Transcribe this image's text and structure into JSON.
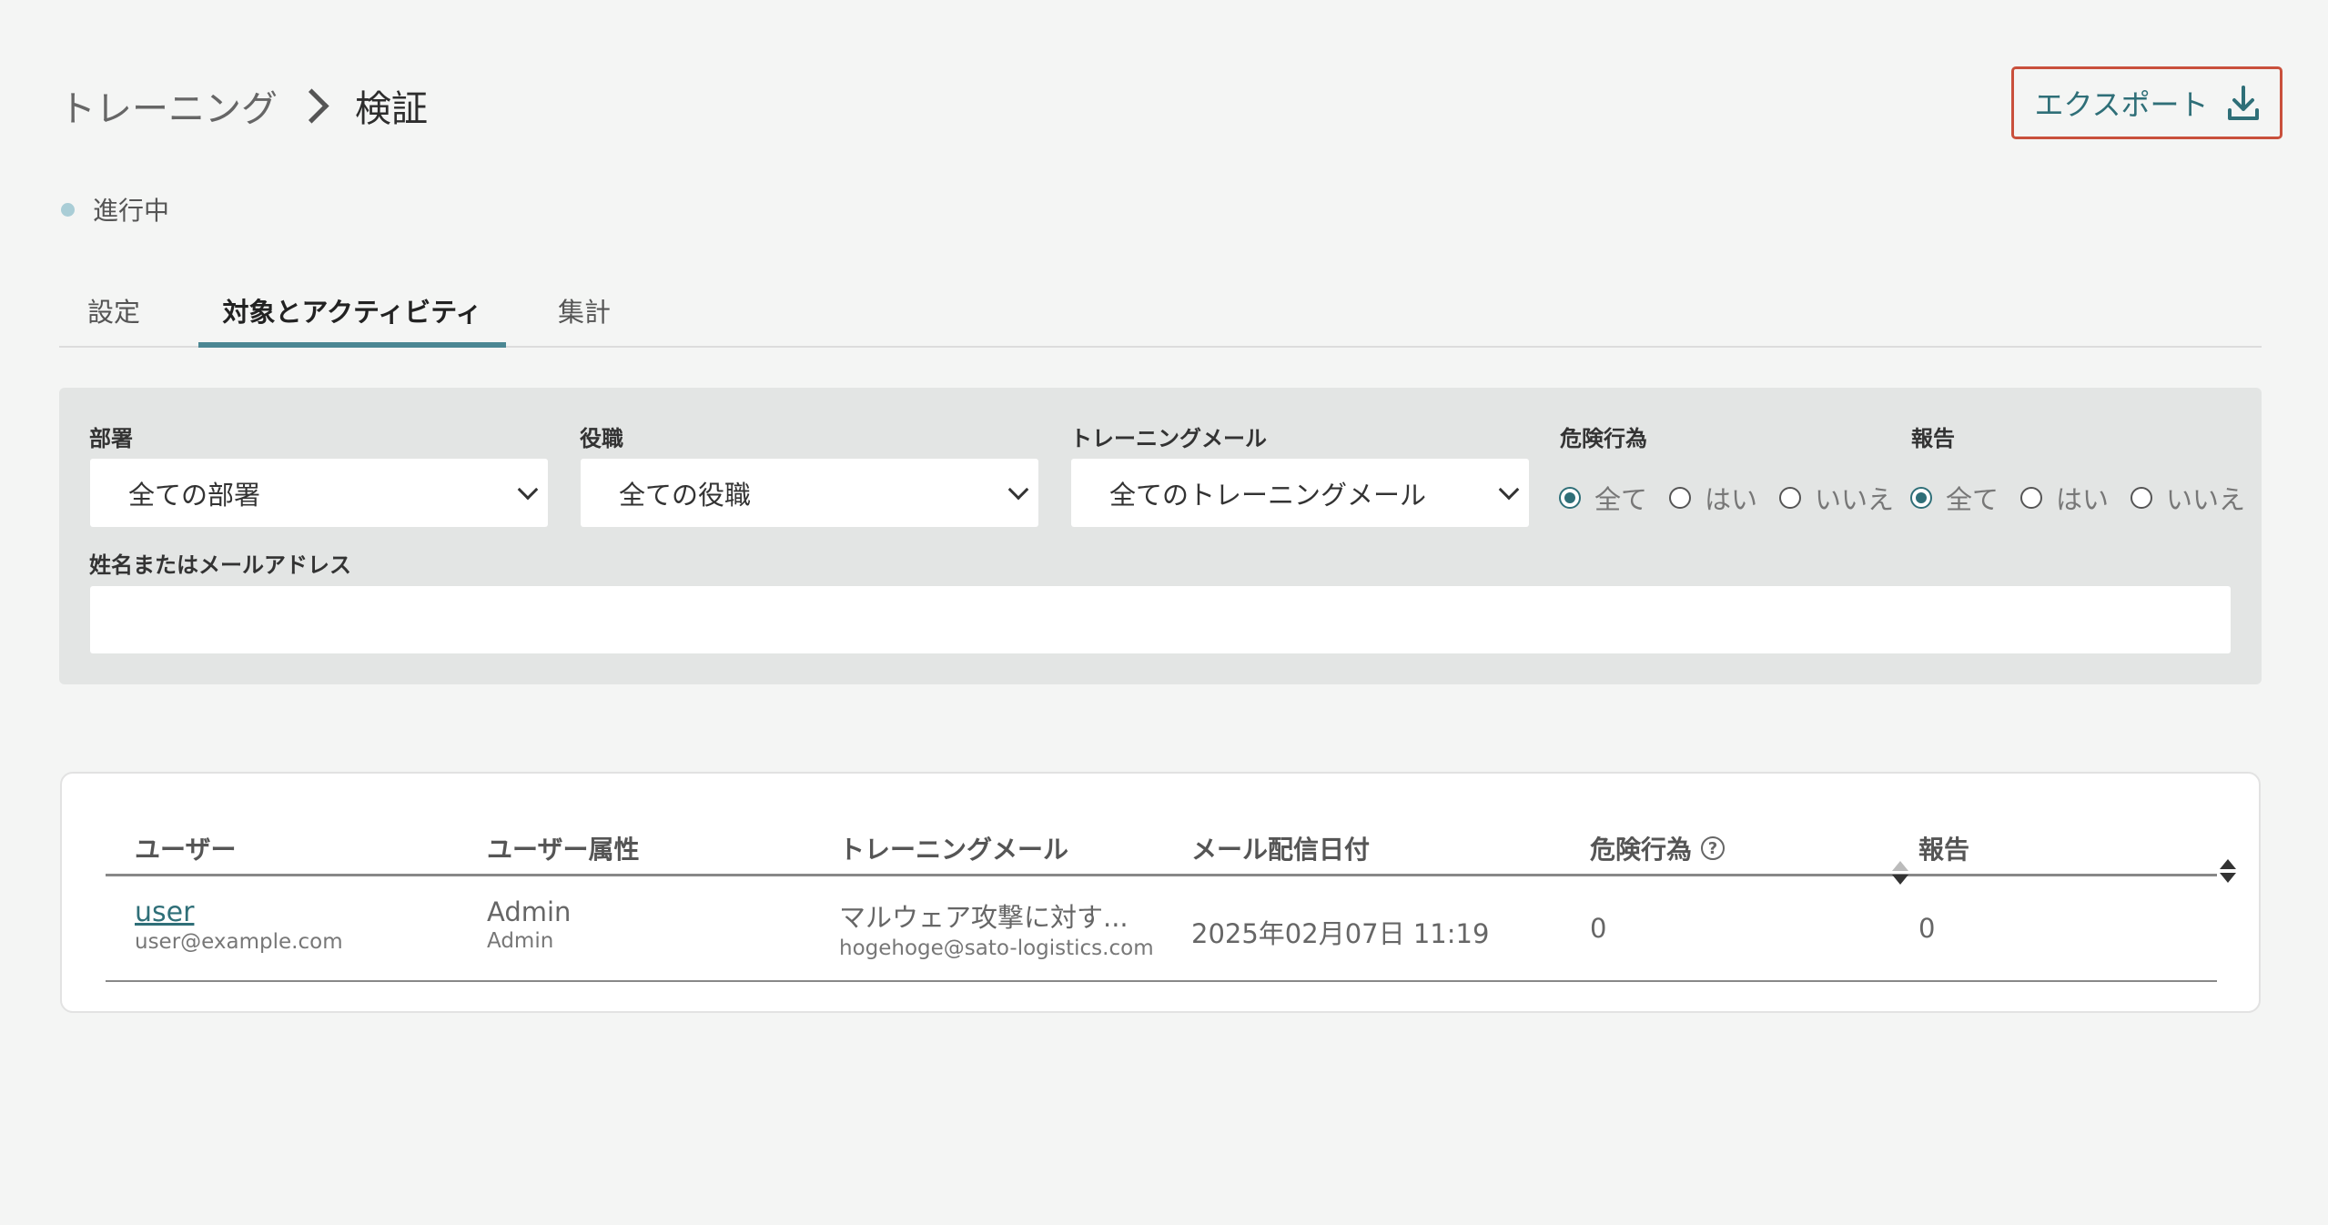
{
  "breadcrumb": {
    "parent": "トレーニング",
    "current": "検証"
  },
  "export_button": {
    "label": "エクスポート",
    "icon": "download-icon"
  },
  "status": {
    "label": "進行中",
    "color": "#a9cdd6"
  },
  "tabs": [
    {
      "label": "設定",
      "active": false
    },
    {
      "label": "対象とアクティビティ",
      "active": true
    },
    {
      "label": "集計",
      "active": false
    }
  ],
  "filters": {
    "department": {
      "label": "部署",
      "value": "全ての部署"
    },
    "position": {
      "label": "役職",
      "value": "全ての役職"
    },
    "training_mail": {
      "label": "トレーニングメール",
      "value": "全てのトレーニングメール"
    },
    "risky_action": {
      "label": "危険行為",
      "options": [
        "全て",
        "はい",
        "いいえ"
      ],
      "selected": "全て"
    },
    "report": {
      "label": "報告",
      "options": [
        "全て",
        "はい",
        "いいえ"
      ],
      "selected": "全て"
    },
    "search": {
      "label": "姓名またはメールアドレス",
      "value": ""
    }
  },
  "table": {
    "columns": [
      "ユーザー",
      "ユーザー属性",
      "トレーニングメール",
      "メール配信日付",
      "危険行為",
      "報告"
    ],
    "rows": [
      {
        "user_name": "user",
        "user_email": "user@example.com",
        "attr_main": "Admin",
        "attr_sub": "Admin",
        "mail_title": "マルウェア攻撃に対す...",
        "mail_from": "hogehoge@sato-logistics.com",
        "sent_date": "2025年02月07日 11:19",
        "risky": "0",
        "report": "0"
      }
    ]
  },
  "colors": {
    "accent": "#2f6f78",
    "tab_underline": "#4b8793",
    "export_border": "#c9503c",
    "background": "#f4f5f4"
  }
}
